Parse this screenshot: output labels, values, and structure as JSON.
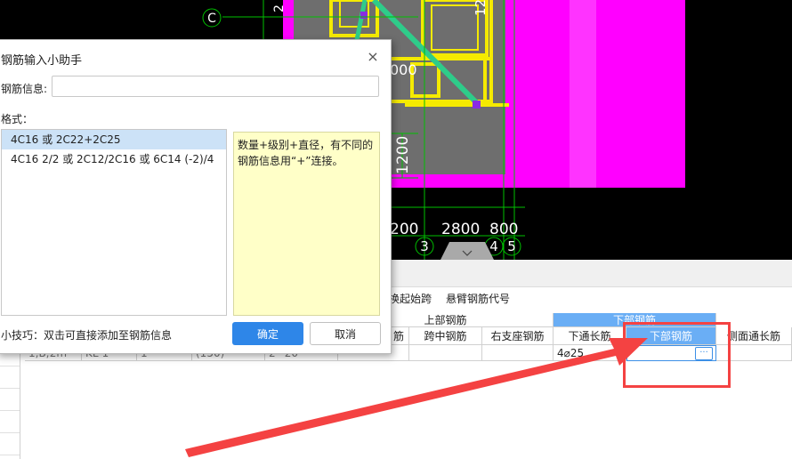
{
  "cad": {
    "labels": {
      "axis_c": "C",
      "dim_2": "2",
      "dim_12": "12",
      "dim_000": "000",
      "dim_1200": "1200",
      "dim_200": "200",
      "dim_2800": "2800",
      "dim_800": "800",
      "axis_3": "3",
      "axis_4": "4",
      "axis_5": "5"
    },
    "colors": {
      "background": "#000000",
      "column": "#ff00ff",
      "beam": "#f5ea00",
      "grid": "#00c000",
      "slab": "#6e6e6e",
      "diagonal": "#2ecc8a"
    }
  },
  "dialog": {
    "title": "钢筋输入小助手",
    "close": "×",
    "info_label": "钢筋信息:",
    "info_value": "",
    "format_label": "格式：",
    "formats": [
      "4C16 或 2C22+2C25",
      "4C16 2/2 或 2C12/2C16 或 6C14 (-2)/4"
    ],
    "description": "数量+级别+直径，有不同的钢筋信息用“+”连接。",
    "tip": "小技巧：双击可直接添加至钢筋信息",
    "ok": "确定",
    "cancel": "取消"
  },
  "toolbar": {
    "swap_span": "换起始跨",
    "cantilever_code": "悬臂钢筋代号"
  },
  "table": {
    "group_top": "上部钢筋",
    "group_bottom": "下部钢筋",
    "headers": [
      "筋",
      "跨中钢筋",
      "右支座钢筋",
      "下通长筋",
      "下部钢筋",
      "侧面通长筋"
    ],
    "row1": {
      "c1": "1,B;2m",
      "c2": "KL-1",
      "c3": "1",
      "c4": "(150)",
      "c5": "2~20",
      "bottom_through": "4⌀25",
      "bottom_rebar": ""
    },
    "ellipsis": "···"
  },
  "annotation": {
    "color": "#f44242"
  }
}
